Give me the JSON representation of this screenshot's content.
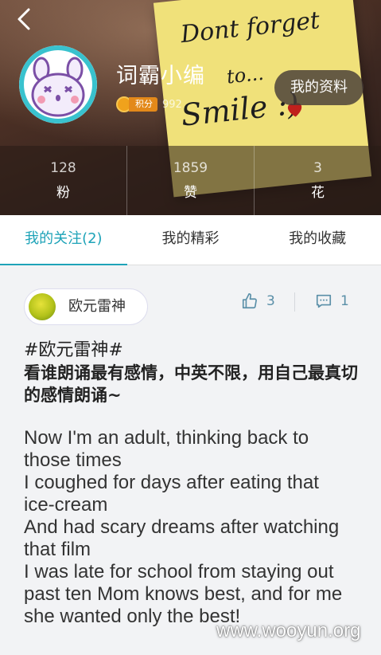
{
  "profile": {
    "username": "词霸小编",
    "points_label": "积分",
    "points_value": "992",
    "profile_button": "我的资料"
  },
  "banner_note": {
    "line1": "Dont forget",
    "line2": "to...",
    "line3": "Smile :)"
  },
  "stats": [
    {
      "value": "128",
      "label": "粉"
    },
    {
      "value": "1859",
      "label": "赞"
    },
    {
      "value": "3",
      "label": "花"
    }
  ],
  "tabs": [
    {
      "label": "我的关注(2)",
      "active": true
    },
    {
      "label": "我的精彩",
      "active": false
    },
    {
      "label": "我的收藏",
      "active": false
    }
  ],
  "post": {
    "author": "欧元雷神",
    "likes": "3",
    "comments": "1",
    "tag": "#欧元雷神#",
    "chinese_text": "看谁朗诵最有感情，中英不限，用自己最真切的感情朗诵~",
    "english_lines": [
      "Now I'm an adult, thinking back to",
      "those times",
      "I coughed for days after eating that",
      "ice-cream",
      "And had scary dreams after watching",
      "that film",
      "I was late for school from staying out",
      "past ten Mom knows best, and for me",
      "she wanted only the best!"
    ]
  },
  "watermark": "www.wooyun.org",
  "colors": {
    "accent": "#1ea3b8",
    "badge": "#e3891a",
    "heart": "#c0201c"
  }
}
